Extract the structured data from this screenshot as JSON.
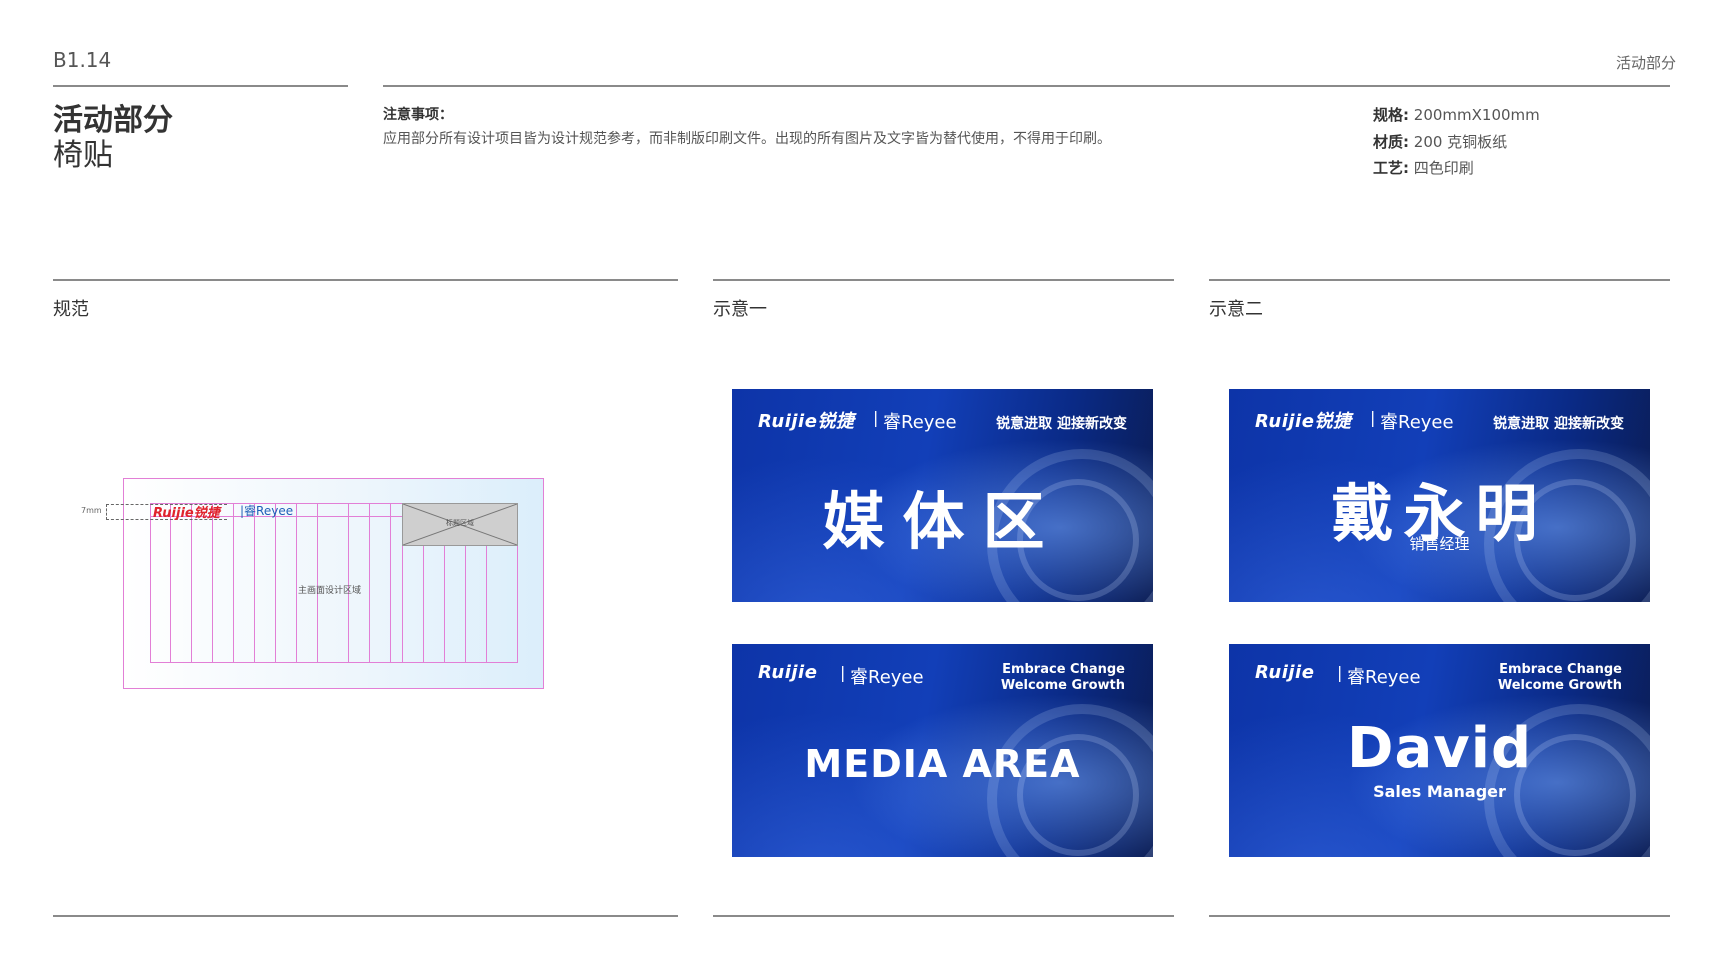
{
  "header": {
    "page_code": "B1.14",
    "section": "活动部分",
    "title_main": "活动部分",
    "title_sub": "椅贴"
  },
  "notice": {
    "label": "注意事项：",
    "text": "应用部分所有设计项目皆为设计规范参考，而非制版印刷文件。出现的所有图片及文字皆为替代使用，不得用于印刷。"
  },
  "specs": [
    {
      "label": "规格:",
      "value": "200mmX100mm"
    },
    {
      "label": "材质:",
      "value": "200 克铜板纸"
    },
    {
      "label": "工艺:",
      "value": "四色印刷"
    }
  ],
  "columns": {
    "spec": "规范",
    "example1": "示意一",
    "example2": "示意二"
  },
  "spec_drawing": {
    "margin_label": "7mm",
    "brand_ruijie": "Ruijie锐捷",
    "brand_reyee": "|睿Reyee",
    "title_area": "标题区域",
    "main_area": "主画面设计区域"
  },
  "signs": [
    {
      "brand": "Ruijie锐捷",
      "sep": "|",
      "reyee": "睿Reyee",
      "tagline": "锐意进取 迎接新改变",
      "big": "媒体区",
      "sub": ""
    },
    {
      "brand": "Ruijie锐捷",
      "sep": "|",
      "reyee": "睿Reyee",
      "tagline": "锐意进取 迎接新改变",
      "big": "戴永明",
      "sub": "销售经理"
    },
    {
      "brand": "Ruijie",
      "sep": "|",
      "reyee": "睿Reyee",
      "tagline_line1": "Embrace Change",
      "tagline_line2": "Welcome Growth",
      "big": "MEDIA AREA",
      "sub": ""
    },
    {
      "brand": "Ruijie",
      "sep": "|",
      "reyee": "睿Reyee",
      "tagline_line1": "Embrace Change",
      "tagline_line2": "Welcome Growth",
      "big": "David",
      "sub": "Sales Manager"
    }
  ]
}
